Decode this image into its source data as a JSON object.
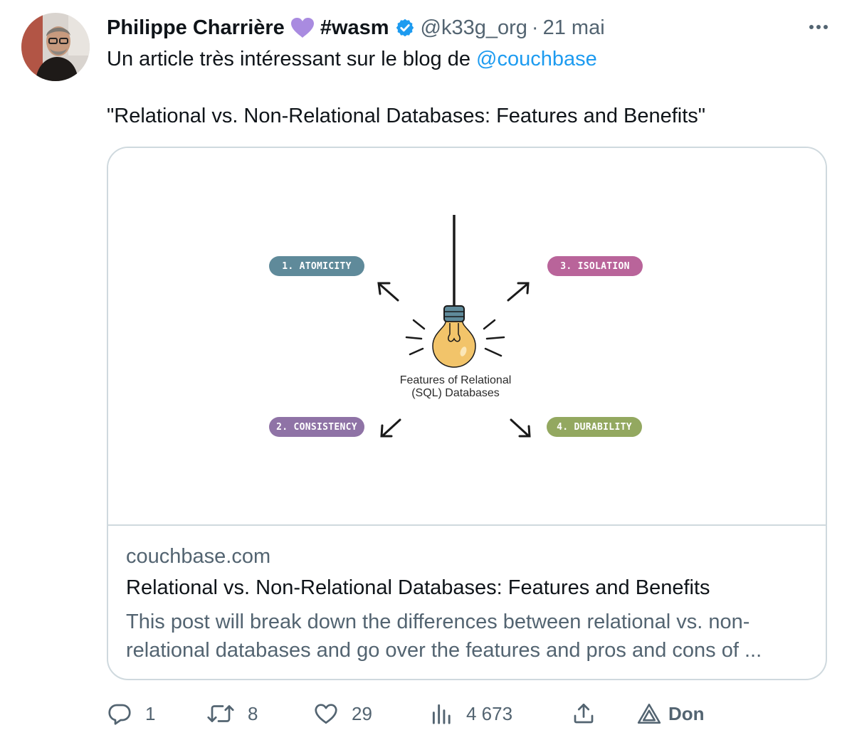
{
  "tweet": {
    "author_name": "Philippe Charrière",
    "name_suffix": "#wasm",
    "handle": "@k33g_org",
    "separator": "·",
    "date": "21 mai",
    "text_before_mention": "Un article très intéressant sur le blog de ",
    "mention": "@couchbase",
    "quote_line": "\"Relational vs. Non-Relational Databases: Features and Benefits\""
  },
  "card": {
    "domain": "couchbase.com",
    "title": "Relational vs. Non-Relational Databases: Features and Benefits",
    "description": "This post will break down the differences between relational vs. non-relational databases and go over the features and pros and cons of ...",
    "diagram": {
      "caption_line1": "Features of Relational",
      "caption_line2": "(SQL) Databases",
      "pills": [
        {
          "label": "1. ATOMICITY",
          "color": "#5f8a9a"
        },
        {
          "label": "2. CONSISTENCY",
          "color": "#8f73a6"
        },
        {
          "label": "3. ISOLATION",
          "color": "#b9649a"
        },
        {
          "label": "4. DURABILITY",
          "color": "#93a860"
        }
      ],
      "bulb_color": "#f2c46a",
      "socket_color": "#5f8a9a"
    }
  },
  "actions": {
    "replies": "1",
    "retweets": "8",
    "likes": "29",
    "views": "4 673",
    "don_label": "Don"
  },
  "colors": {
    "heart": "#a98be0",
    "verified": "#1d9bf0",
    "mention": "#1d9bf0",
    "secondary_text": "#536471",
    "border": "#cfd9de"
  }
}
